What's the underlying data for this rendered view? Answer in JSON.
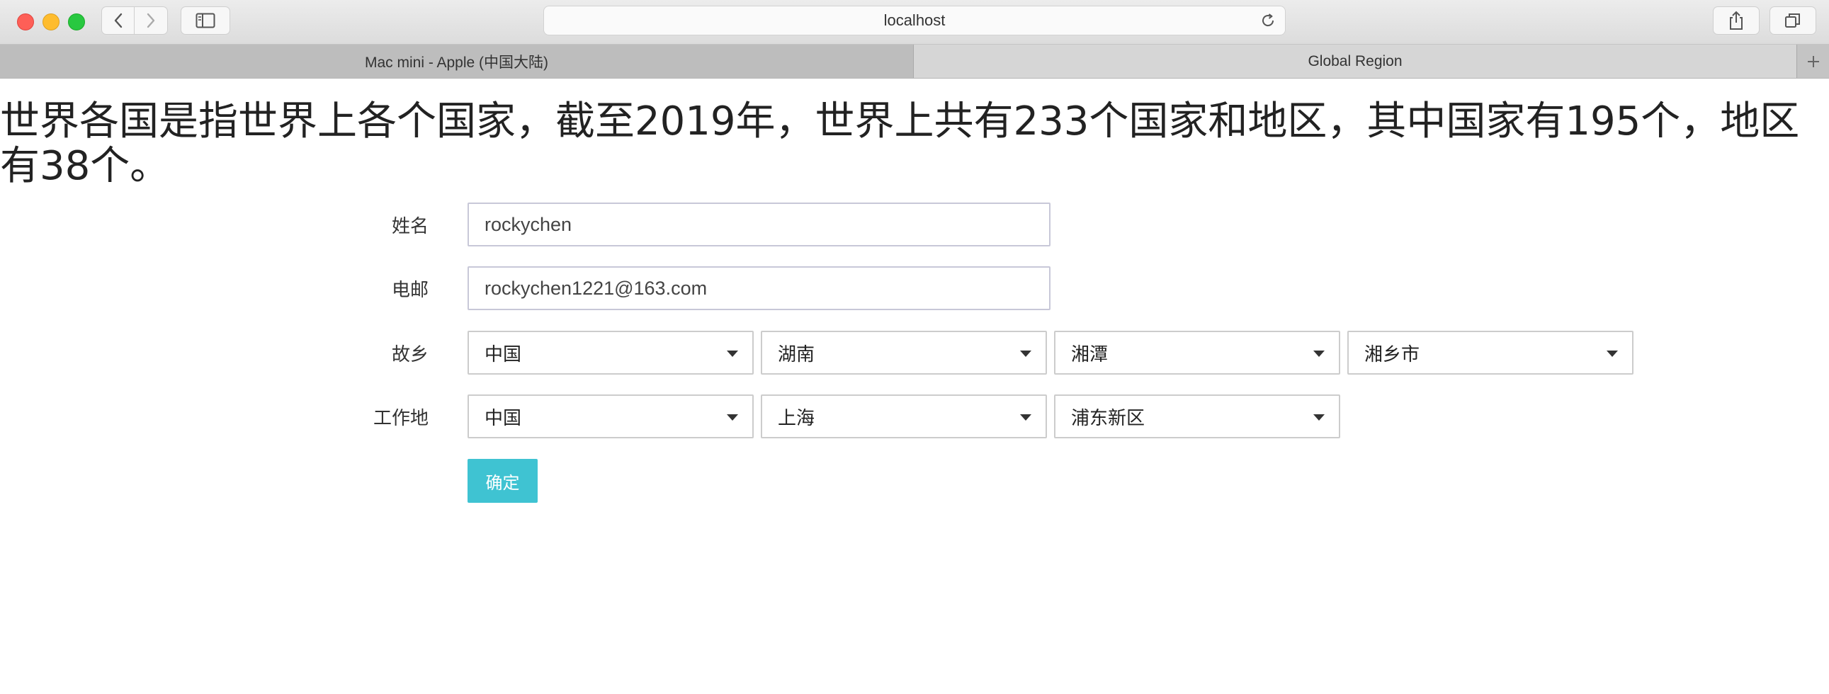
{
  "browser": {
    "url": "localhost",
    "tabs": [
      {
        "title": "Mac mini - Apple (中国大陆)",
        "active": false
      },
      {
        "title": "Global Region",
        "active": true
      }
    ]
  },
  "page": {
    "heading": "世界各国是指世界上各个国家，截至2019年，世界上共有233个国家和地区，其中国家有195个，地区有38个。"
  },
  "form": {
    "name": {
      "label": "姓名",
      "value": "rockychen"
    },
    "email": {
      "label": "电邮",
      "value": "rockychen1221@163.com"
    },
    "hometown": {
      "label": "故乡",
      "selects": [
        "中国",
        "湖南",
        "湘潭",
        "湘乡市"
      ]
    },
    "workplace": {
      "label": "工作地",
      "selects": [
        "中国",
        "上海",
        "浦东新区"
      ]
    },
    "submit_label": "确定"
  },
  "colors": {
    "accent": "#3fc3d2",
    "close": "#fe5f57",
    "minimize": "#febc2e",
    "maximize": "#28c840"
  }
}
